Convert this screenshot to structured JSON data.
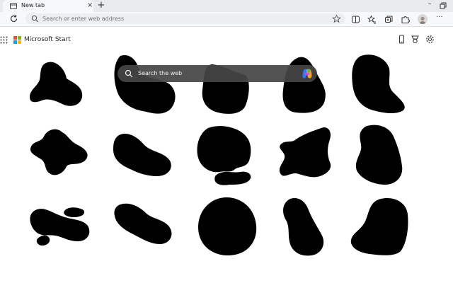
{
  "browser": {
    "tab": {
      "title": "New tab",
      "close_glyph": "×",
      "icon": "tab-page-icon"
    },
    "new_tab_glyph": "+",
    "window_controls": {
      "minimize_glyph": "–",
      "restore_icon": "restore-icon"
    },
    "address_bar": {
      "placeholder": "Search or enter web address"
    },
    "toolbar_icons": [
      "split-screen-icon",
      "favorites-icon",
      "collections-icon",
      "extensions-icon",
      "profile-avatar"
    ],
    "more_glyph": "···"
  },
  "new_tab_page": {
    "brand": "Microsoft Start",
    "header_icons": [
      "phone-icon",
      "rewards-icon",
      "settings-icon"
    ],
    "search": {
      "placeholder": "Search the web"
    },
    "colors": {
      "blob": "#000000",
      "search_bg": "#464646",
      "page_bg": "#ffffff"
    }
  }
}
